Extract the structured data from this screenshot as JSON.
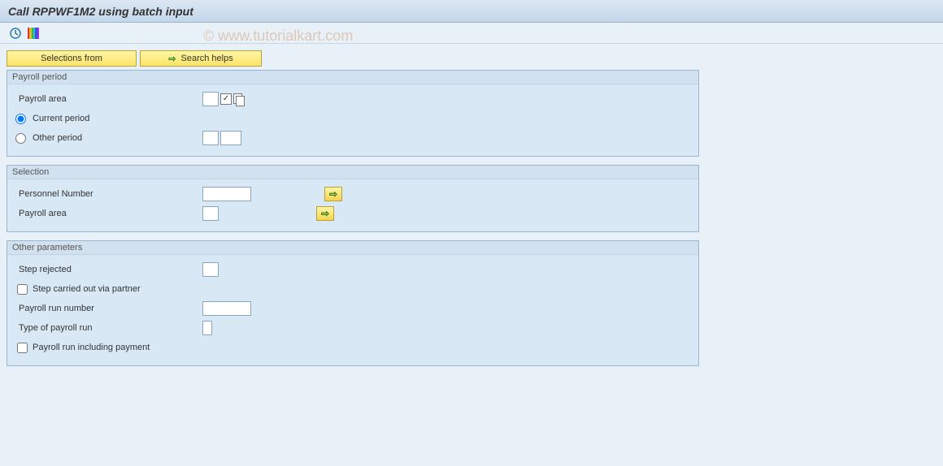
{
  "title": "Call RPPWF1M2 using batch input",
  "watermark": "© www.tutorialkart.com",
  "action_buttons": {
    "selections_from": "Selections from",
    "search_helps": "Search helps"
  },
  "groups": {
    "payroll_period": {
      "title": "Payroll period",
      "rows": {
        "payroll_area_label": "Payroll area",
        "current_period_label": "Current period",
        "other_period_label": "Other period"
      }
    },
    "selection": {
      "title": "Selection",
      "rows": {
        "personnel_number_label": "Personnel Number",
        "payroll_area_label": "Payroll area"
      }
    },
    "other_params": {
      "title": "Other parameters",
      "rows": {
        "step_rejected_label": "Step rejected",
        "step_partner_label": "Step carried out via partner",
        "payroll_run_number_label": "Payroll run number",
        "type_of_payroll_run_label": "Type of payroll run",
        "including_payment_label": "Payroll run including payment"
      }
    }
  },
  "icons": {
    "execute": "clock-icon",
    "palette": "rainbow-bars"
  }
}
